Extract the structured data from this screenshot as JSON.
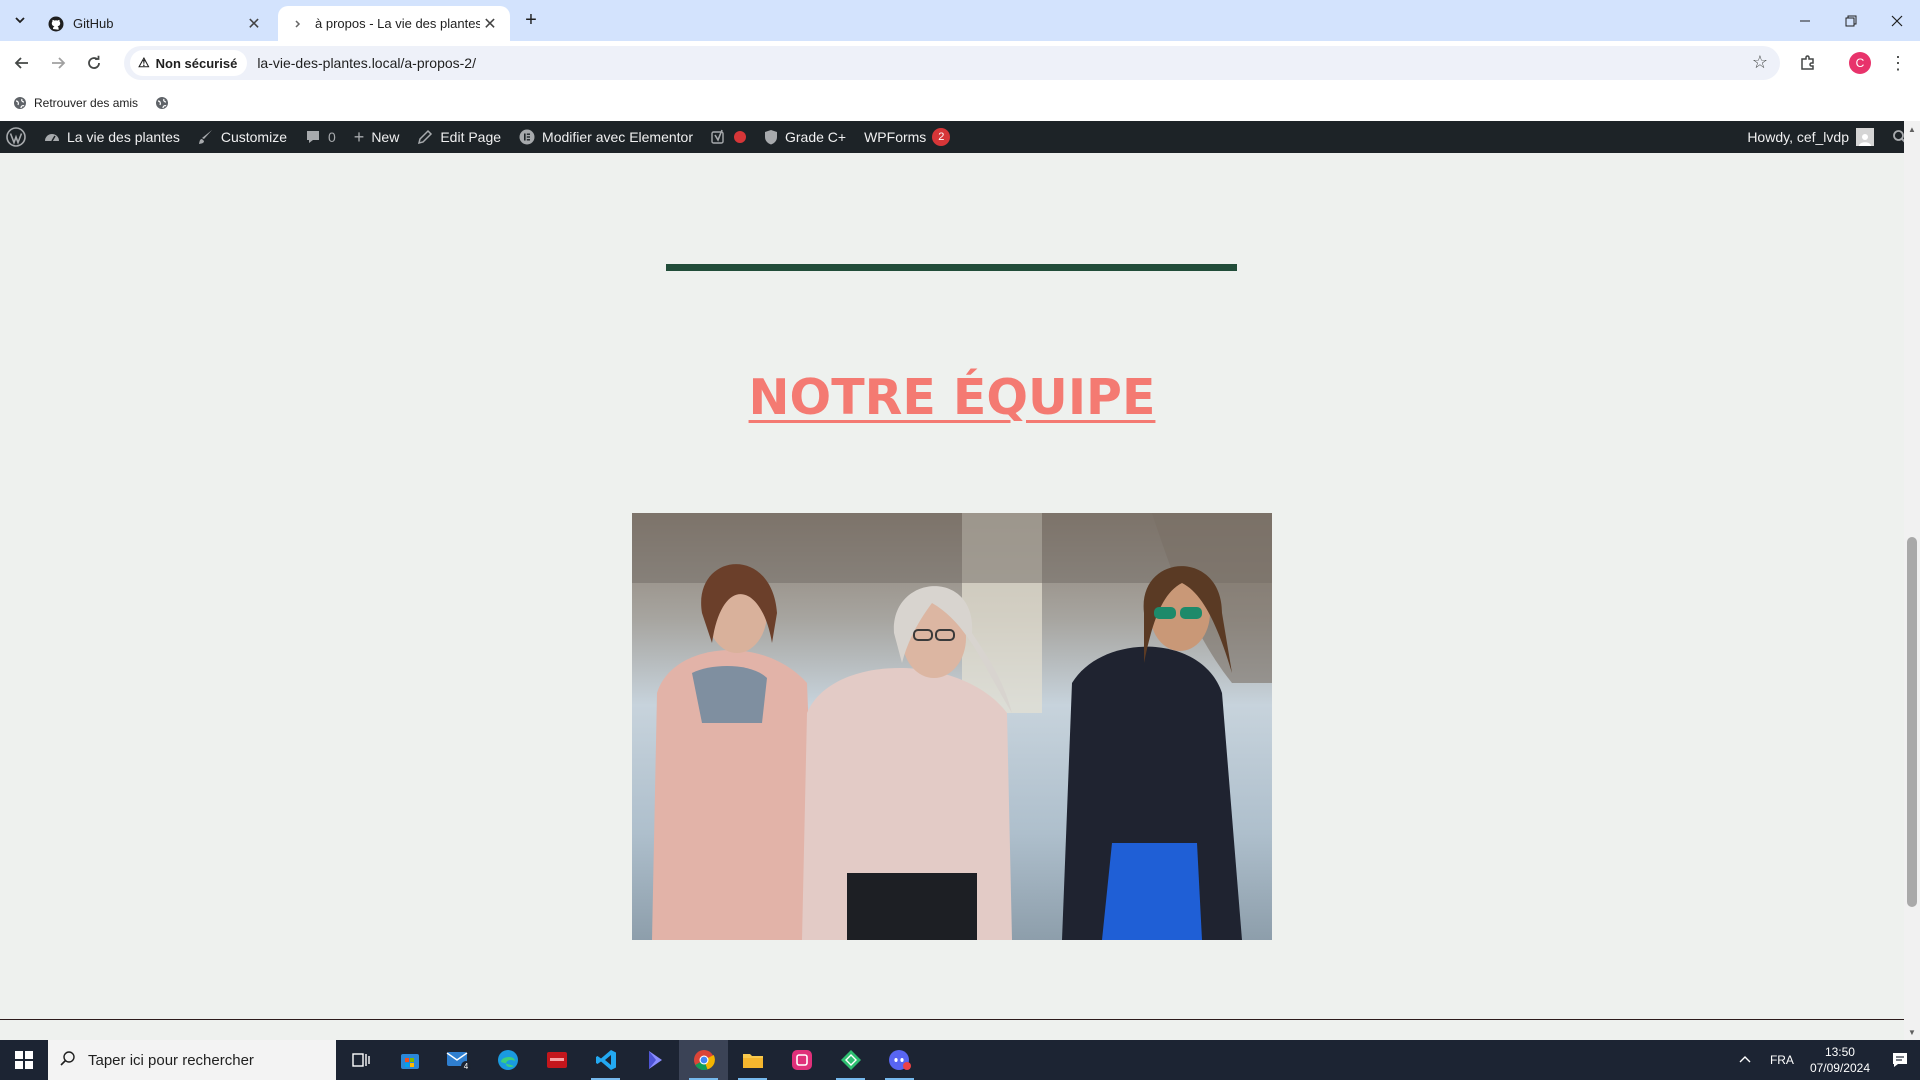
{
  "browser": {
    "tabs": [
      {
        "title": "GitHub",
        "icon": "github-icon",
        "active": false
      },
      {
        "title": "à propos - La vie des plantes",
        "icon": "loading-icon",
        "active": true
      }
    ],
    "security_label": "Non sécurisé",
    "url": "la-vie-des-plantes.local/a-propos-2/",
    "profile_initial": "C",
    "bookmarks": [
      {
        "label": "Retrouver des amis",
        "icon": "globe-icon"
      }
    ]
  },
  "admin_bar": {
    "site_name": "La vie des plantes",
    "customize": "Customize",
    "comments_count": "0",
    "new": "New",
    "edit_page": "Edit Page",
    "elementor": "Modifier avec Elementor",
    "grade": "Grade C+",
    "wpforms": "WPForms",
    "wpforms_badge": "2",
    "howdy": "Howdy, cef_lvdp"
  },
  "page": {
    "heading": "NOTRE ÉQUIPE",
    "image_alt": "Trois femmes marchant en extérieur",
    "colors": {
      "heading": "#f47a72",
      "divider": "#214d39",
      "background": "#eef1ee"
    }
  },
  "taskbar": {
    "search_placeholder": "Taper ici pour rechercher",
    "mail_badge": "4",
    "language": "FRA",
    "time": "13:50",
    "date": "07/09/2024"
  }
}
